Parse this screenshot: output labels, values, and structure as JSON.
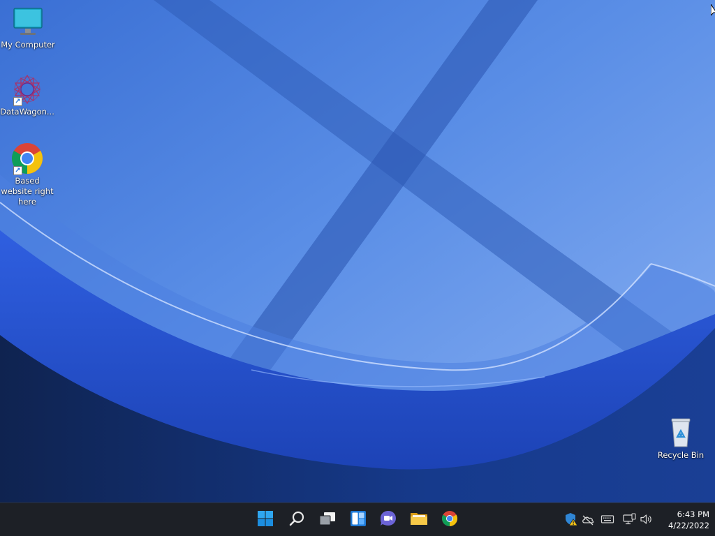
{
  "desktop": {
    "icons": [
      {
        "label": "My Computer",
        "icon": "monitor-icon"
      },
      {
        "label": "DataWagon...",
        "icon": "datawagon-logo-icon",
        "shortcut": true
      },
      {
        "label": "Based website right here",
        "icon": "chrome-icon",
        "shortcut": true
      },
      {
        "label": "Recycle Bin",
        "icon": "recycle-bin-icon"
      }
    ]
  },
  "taskbar": {
    "buttons": [
      {
        "name": "start",
        "icon": "windows-logo-icon"
      },
      {
        "name": "search",
        "icon": "search-icon"
      },
      {
        "name": "task-view",
        "icon": "task-view-icon"
      },
      {
        "name": "widgets",
        "icon": "widgets-icon"
      },
      {
        "name": "teams-chat",
        "icon": "chat-icon"
      },
      {
        "name": "file-explorer",
        "icon": "folder-icon"
      },
      {
        "name": "chrome",
        "icon": "chrome-icon"
      }
    ],
    "tray": {
      "icons": [
        "defender-warning-icon",
        "onedrive-offline-icon",
        "keyboard-icon",
        "network-icon",
        "volume-icon"
      ]
    },
    "clock": {
      "time": "6:43 PM",
      "date": "4/22/2022"
    }
  },
  "colors": {
    "taskbar_bg": "#1d2026",
    "accent": "#0078d4",
    "wallpaper_blue": "#3f74d6"
  }
}
